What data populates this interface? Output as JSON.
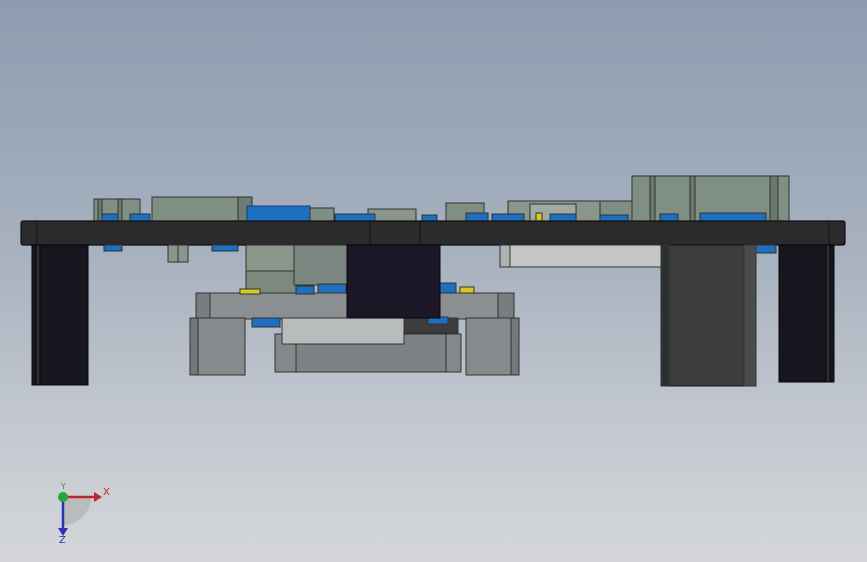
{
  "viewport": {
    "background_top": "#8e9cb0",
    "background_bottom": "#d4d6d9"
  },
  "model": {
    "board_color": "#2b2b2d",
    "standoff_color": "#16161e",
    "component_green": "#7f8f83",
    "connector_blue": "#1f6fc0",
    "accent_yellow": "#d9c81f",
    "heatsink_dark": "#1c1726",
    "housing_gray": "#8c8f91",
    "panel_light": "#c4c6c6"
  },
  "triad": {
    "x_label": "X",
    "y_label": "Y",
    "z_label": "Z",
    "x_color": "#c0282d",
    "y_color": "#22a83a",
    "z_color": "#2a32b8"
  }
}
